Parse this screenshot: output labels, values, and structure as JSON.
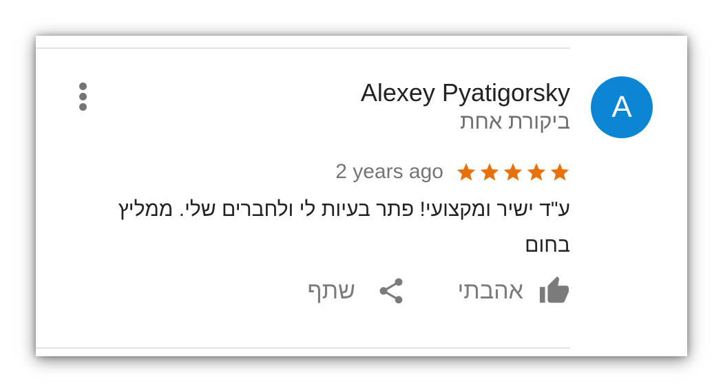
{
  "review": {
    "avatar_letter": "A",
    "avatar_color": "#0b86d4",
    "reviewer_name": "Alexey Pyatigorsky",
    "reviewer_meta": "ביקורת אחת",
    "rating": 5,
    "rating_max": 5,
    "star_color": "#e8710a",
    "timestamp": "2 years ago",
    "text": "ע\"ד ישיר ומקצועי! פתר בעיות לי ולחברים שלי. ממליץ בחום",
    "menu_icon": "more-vert-icon"
  },
  "actions": {
    "like_label": "אהבתי",
    "like_icon": "thumb-up-icon",
    "share_label": "שתף",
    "share_icon": "share-icon"
  }
}
